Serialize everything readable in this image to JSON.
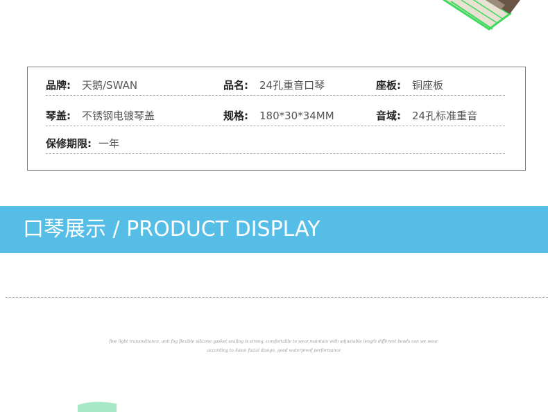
{
  "specs": {
    "rows": [
      [
        {
          "label": "品牌:",
          "value": "天鹅/SWAN"
        },
        {
          "label": "品名:",
          "value": "24孔重音口琴"
        },
        {
          "label": "座板:",
          "value": "铜座板"
        }
      ],
      [
        {
          "label": "琴盖:",
          "value": "不锈钢电镀琴盖"
        },
        {
          "label": "规格:",
          "value": "180*30*34MM"
        },
        {
          "label": "音域:",
          "value": "24孔标准重音"
        }
      ],
      [
        {
          "label": "保修期限:",
          "value": "一年"
        }
      ]
    ]
  },
  "banner": {
    "title": "口琴展示 / PRODUCT DISPLAY",
    "color": "#55bde6"
  },
  "description": {
    "line1": "fine light transmittance, anti fog flexible silicone gasket sealing is strong, comfortable to wear,maintain with adjustable length different beads can we wear.",
    "line2": "according to Asian facial design, good waterproof performance"
  },
  "colors": {
    "product_green": "#3fd95f",
    "accent": "#55bde6"
  }
}
